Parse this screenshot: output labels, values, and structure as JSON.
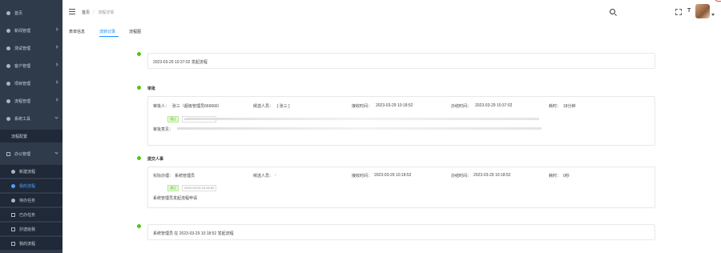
{
  "sidebar": {
    "items": [
      {
        "label": "首页"
      },
      {
        "label": "新闻管理"
      },
      {
        "label": "测试管理"
      },
      {
        "label": "客户管理"
      },
      {
        "label": "项目管理"
      },
      {
        "label": "流程管理"
      },
      {
        "label": "系统工具"
      },
      {
        "label": "流程配置"
      },
      {
        "label": "办公管理"
      },
      {
        "label": "新建流程"
      },
      {
        "label": "我的流程"
      },
      {
        "label": "待办任务"
      },
      {
        "label": "已办任务"
      },
      {
        "label": "抄送给我"
      },
      {
        "label": "我的流程"
      }
    ]
  },
  "header": {
    "breadcrumb": [
      "首页",
      "流程详情"
    ]
  },
  "tabs": [
    {
      "label": "表单信息"
    },
    {
      "label": "流转记录"
    },
    {
      "label": "流程图"
    }
  ],
  "timeline": {
    "start": {
      "text": "2023-03-29 10:37:02 发起流程"
    },
    "node1": {
      "title": "审批",
      "assignee_label": "审批人：",
      "assignee": "张三（超级管理员666666）",
      "candidate_label": "候选人员：",
      "candidate": "[ 张三 ]",
      "received_label": "接收时间：",
      "received": "2023-03-29 10:18:52",
      "handled_label": "办结时间：",
      "handled": "2023-03-29 10:37:02",
      "duration_label": "耗时：",
      "duration": "18分钟",
      "tag": "通过",
      "tag_time": "2023-03-29 10:37:02",
      "comment_label": "审批意见："
    },
    "node2": {
      "title": "提交人事",
      "assignee_label": "实际办理：",
      "assignee": "系统管理员",
      "candidate_label": "候选人员：",
      "candidate": "-",
      "received_label": "接收时间：",
      "received": "2023-03-29 10:18:52",
      "handled_label": "办结时间：",
      "handled": "2023-03-29 10:18:52",
      "duration_label": "耗时：",
      "duration": "0秒",
      "tag": "通过",
      "tag_time": "2023-03-29 10:18:52",
      "comment": "系统管理员发起流程申请"
    },
    "end": {
      "text": "系统管理员 在 2023-03-29 10:18:52 发起流程"
    }
  }
}
